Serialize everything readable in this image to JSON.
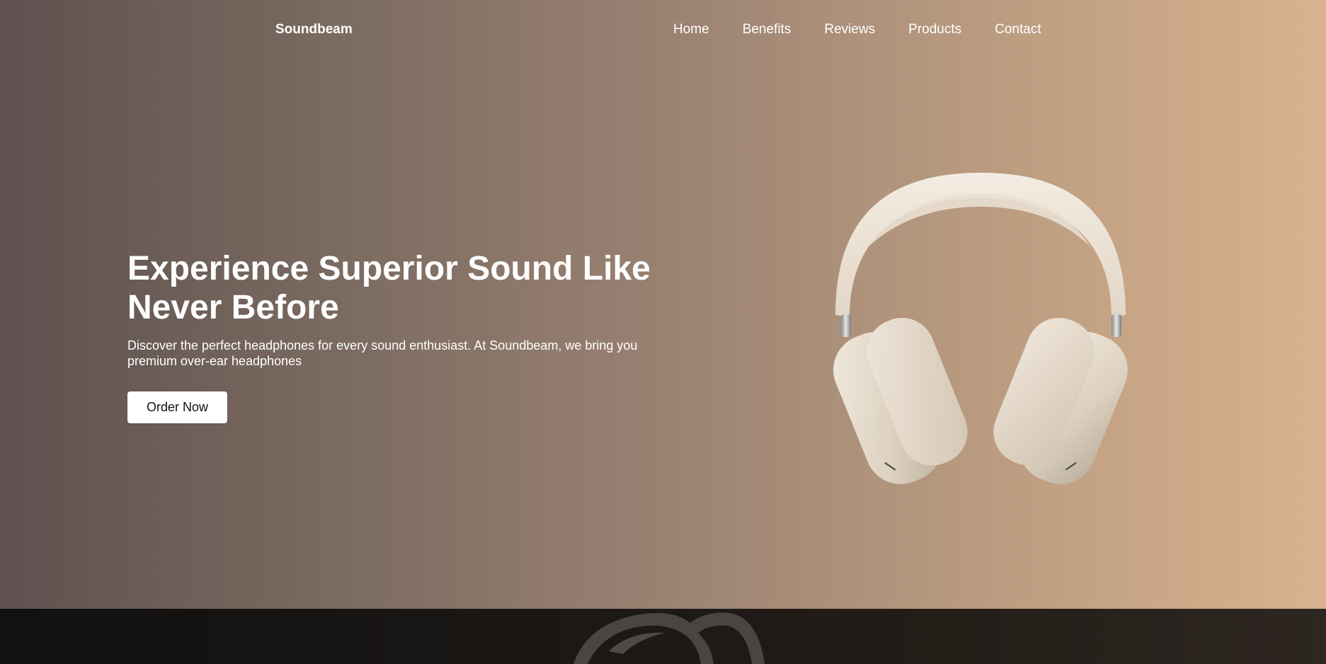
{
  "brand": {
    "name": "Soundbeam"
  },
  "nav": {
    "items": [
      "Home",
      "Benefits",
      "Reviews",
      "Products",
      "Contact"
    ]
  },
  "hero": {
    "headline": "Experience Superior Sound Like Never Before",
    "subtext": "Discover the perfect headphones for every sound enthusiast. At Soundbeam, we bring you premium over-ear headphones",
    "cta_label": "Order Now",
    "image_icon": "headphones-image",
    "gradient_start": "#5e514f",
    "gradient_end": "#d8b38e"
  },
  "next_section": {
    "image_icon": "dark-headphones-image",
    "background": "#1a1715"
  }
}
